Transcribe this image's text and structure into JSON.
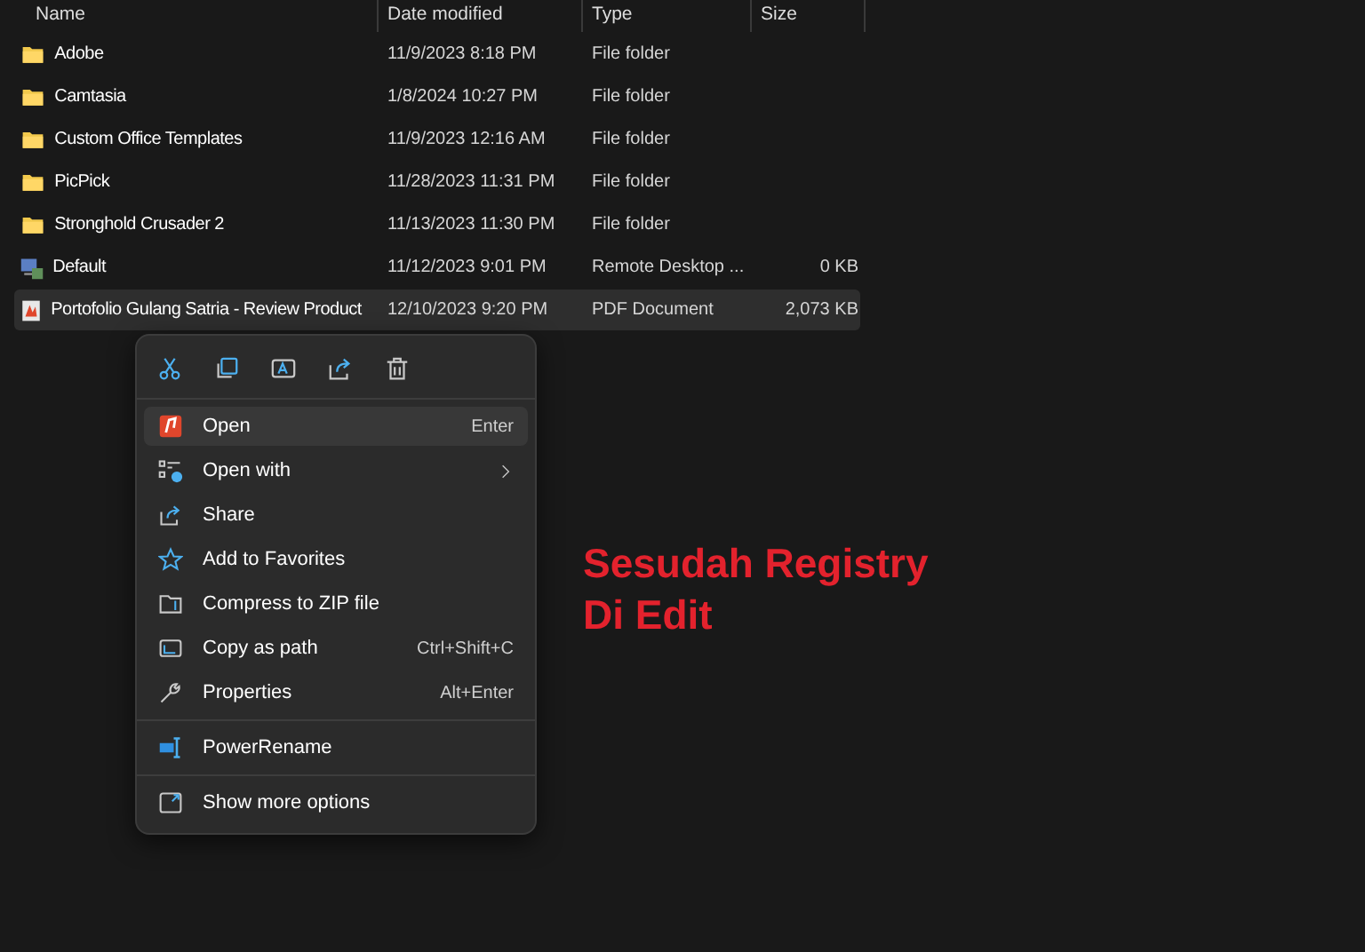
{
  "columns": [
    "Name",
    "Date modified",
    "Type",
    "Size"
  ],
  "rows": [
    {
      "kind": "folder",
      "name": "Adobe",
      "date": "11/9/2023 8:18 PM",
      "type": "File folder",
      "selected": false
    },
    {
      "kind": "folder",
      "name": "Camtasia",
      "date": "1/8/2024 10:27 PM",
      "type": "File folder",
      "selected": false
    },
    {
      "kind": "folder",
      "name": "Custom Office Templates",
      "date": "11/9/2023 12:16 AM",
      "type": "File folder",
      "selected": false
    },
    {
      "kind": "folder",
      "name": "PicPick",
      "date": "11/28/2023 11:31 PM",
      "type": "File folder",
      "selected": false
    },
    {
      "kind": "folder",
      "name": "Stronghold Crusader 2",
      "date": "11/13/2023 11:30 PM",
      "type": "File folder",
      "selected": false
    },
    {
      "kind": "remote",
      "name": "Default",
      "date": "11/12/2023 9:01 PM",
      "type": "Remote Desktop ...",
      "size": "0 KB",
      "selected": false
    },
    {
      "kind": "pdf",
      "name": "Portofolio Gulang Satria - Review Product",
      "date": "12/10/2023 9:20 PM",
      "type": "PDF Document",
      "size": "2,073 KB",
      "selected": true
    }
  ],
  "context_menu": {
    "items": [
      {
        "kind": "item",
        "label": "Open",
        "shortcut": "Enter",
        "selected": true
      },
      {
        "kind": "item",
        "label": "Open with",
        "submenu": true,
        "selected": false
      },
      {
        "kind": "item",
        "label": "Share",
        "selected": false
      },
      {
        "kind": "item",
        "label": "Add to Favorites",
        "selected": false
      },
      {
        "kind": "item",
        "label": "Compress to ZIP file",
        "selected": false
      },
      {
        "kind": "item",
        "label": "Copy as path",
        "shortcut": "Ctrl+Shift+C",
        "selected": false
      },
      {
        "kind": "item",
        "label": "Properties",
        "shortcut": "Alt+Enter",
        "selected": false
      },
      {
        "kind": "separator"
      },
      {
        "kind": "item",
        "label": "PowerRename",
        "selected": false
      },
      {
        "kind": "separator"
      },
      {
        "kind": "item",
        "label": "Show more options",
        "selected": false
      }
    ]
  },
  "annotation": "Sesudah Registry Di Edit"
}
